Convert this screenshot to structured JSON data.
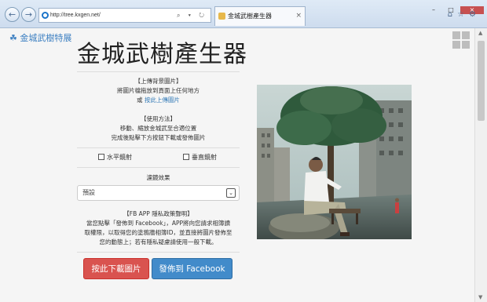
{
  "browser": {
    "url": "http://tree.kxgen.net/",
    "address_tools": "⌕ ▾ ↻",
    "tab_title": "金城武樹產生器",
    "tab_close": "×",
    "home_icon": "⌂",
    "star_icon": "☆",
    "gear_icon": "⚙",
    "back_icon": "←",
    "forward_icon": "→"
  },
  "header": {
    "brand": "金城武樹特展",
    "title": "金城武樹產生器"
  },
  "upload": {
    "heading": "【上傳背景圖片】",
    "line1": "將圖片檔拖放到頁面上任何地方",
    "or": "或",
    "link": "按此上傳圖片"
  },
  "usage": {
    "heading": "【使用方法】",
    "line1": "移動、縮放金城武至合適位置",
    "line2": "完成後點擊下方按鈕下載或發佈圖片"
  },
  "options": {
    "horizontal_flip": "水平鏡射",
    "vertical_flip": "垂直鏡射"
  },
  "filter": {
    "label": "濾鏡效果",
    "selected": "預設",
    "arrow": "⌄"
  },
  "privacy": {
    "heading": "【FB APP 隱私政策聲明】",
    "line1": "當您點擊「發佈到 Facebook」，APP將向您請求相簿讀",
    "line2": "取權限，以取得您的塗鴉牆相簿ID，並直接將圖片發佈至",
    "line3": "您的動態上；若有隱私疑慮請使用一般下載。"
  },
  "buttons": {
    "download": "按此下載圖片",
    "publish": "發佈到 Facebook"
  },
  "colors": {
    "accent": "#337ab7",
    "danger": "#d9534f",
    "primary": "#428bca"
  }
}
